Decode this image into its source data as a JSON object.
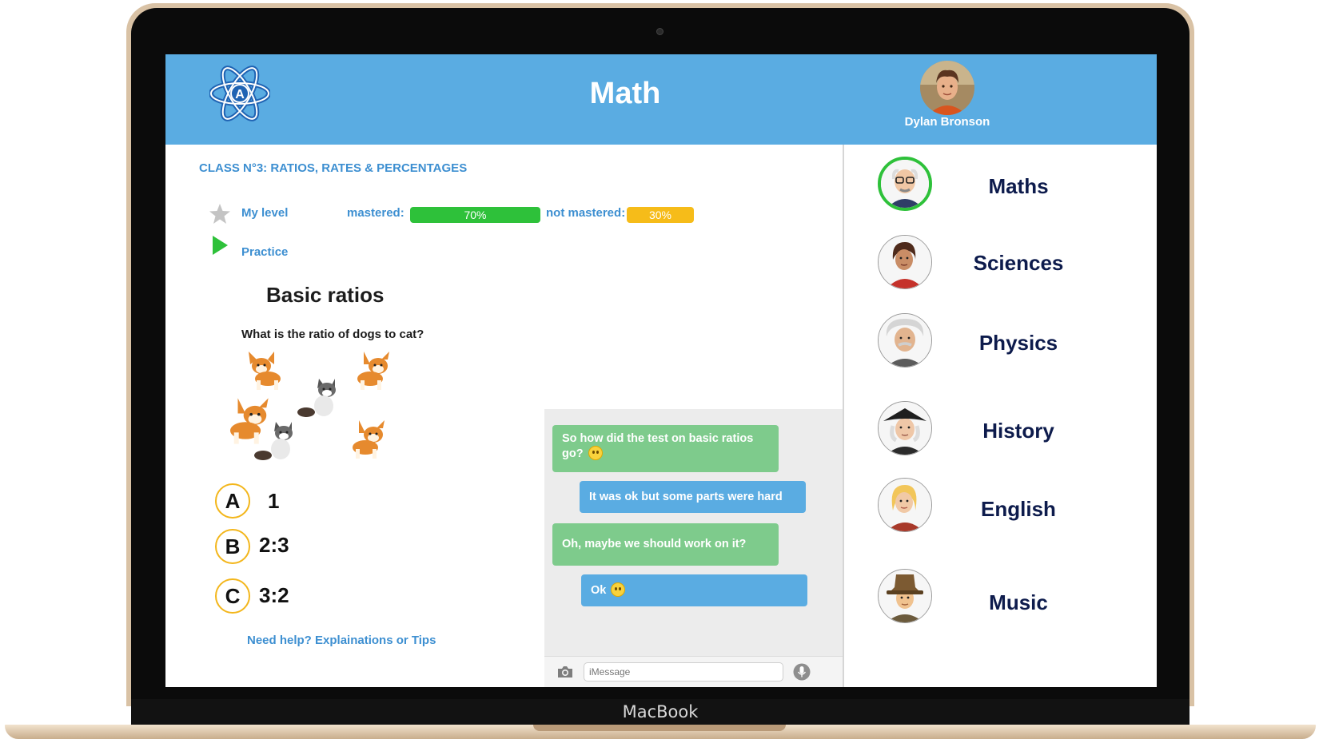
{
  "device": {
    "brand": "MacBook"
  },
  "header": {
    "title": "Math",
    "user": {
      "name": "Dylan Bronson"
    },
    "colors": {
      "bar": "#5aace2",
      "logo": "#1f63b3"
    }
  },
  "lesson": {
    "class_title": "CLASS N°3: RATIOS, RATES & PERCENTAGES",
    "my_level_label": "My level",
    "mastered_label": "mastered:",
    "mastered_value": "70%",
    "mastered_fraction": 0.7,
    "not_mastered_label": "not mastered:",
    "not_mastered_value": "30%",
    "not_mastered_fraction": 0.3,
    "practice_label": "Practice",
    "title": "Basic ratios",
    "question": "What is the ratio of dogs to cat?",
    "answers": [
      {
        "letter": "A",
        "text": "1"
      },
      {
        "letter": "B",
        "text": "2:3"
      },
      {
        "letter": "C",
        "text": "3:2"
      }
    ],
    "help_link": "Need help? Explainations or Tips",
    "colors": {
      "accent": "#3d8fd1",
      "mastered": "#2ec13a",
      "not_mastered": "#f6bc19",
      "answer_ring": "#f3b61b"
    }
  },
  "chat": {
    "messages": [
      {
        "from": "tutor",
        "text": "So how did the test on basic ratios go?",
        "emoji": "smile"
      },
      {
        "from": "student",
        "text": "It was ok but some parts were hard"
      },
      {
        "from": "tutor",
        "text": "Oh, maybe we should work on it?"
      },
      {
        "from": "student",
        "text": "Ok",
        "emoji": "smile"
      }
    ],
    "input_placeholder": "iMessage",
    "colors": {
      "tutor": "#7ecb8c",
      "student": "#5aace2"
    }
  },
  "subjects": [
    {
      "label": "Maths",
      "active": true
    },
    {
      "label": "Sciences",
      "active": false
    },
    {
      "label": "Physics",
      "active": false
    },
    {
      "label": "History",
      "active": false
    },
    {
      "label": "English",
      "active": false
    },
    {
      "label": "Music",
      "active": false
    }
  ]
}
